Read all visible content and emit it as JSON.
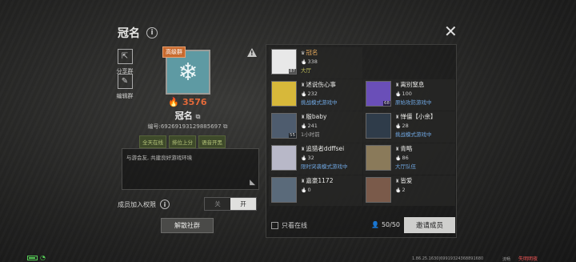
{
  "dialog": {
    "title": "冠名",
    "close_glyph": "✕"
  },
  "side_buttons": [
    {
      "label": "分享群",
      "icon": "share-icon"
    },
    {
      "label": "编辑群",
      "icon": "edit-icon"
    }
  ],
  "group": {
    "tier_label": "高级群",
    "heat": "3576",
    "name": "冠名",
    "id_text": "编号:69269193129885697",
    "tags": [
      "全天在线",
      "排位上分",
      "语音开黑"
    ],
    "description": "与游会友, 共建良好游戏环境",
    "permission_label": "成员加入权限",
    "toggle_off": "关",
    "toggle_on": "开",
    "toggle_state": "on",
    "disband_label": "解散社群"
  },
  "members": [
    {
      "name": "冠名",
      "score": "338",
      "status": "大厅",
      "status_type": "lobby",
      "owner": true,
      "level": "87",
      "avatar_color": "#e8e8e8"
    },
    {
      "name": "述说伤心事",
      "score": "232",
      "status": "挑战模式游戏中",
      "status_type": "playing",
      "owner": false,
      "level": "",
      "avatar_color": "#d7b83a"
    },
    {
      "name": "离别窒息",
      "score": "100",
      "status": "原始攻防游戏中",
      "status_type": "playing",
      "owner": false,
      "level": "68",
      "avatar_color": "#6a4fb8"
    },
    {
      "name": "殷baby",
      "score": "241",
      "status": "1小时前",
      "status_type": "idle",
      "owner": false,
      "level": "55",
      "avatar_color": "#4e5c6e"
    },
    {
      "name": "惮僵【小余】",
      "score": "28",
      "status": "挑战模式游戏中",
      "status_type": "playing",
      "owner": false,
      "level": "",
      "avatar_color": "#2f3c4a"
    },
    {
      "name": "追猎者ddffsei",
      "score": "32",
      "status": "限时突袭模式游戏中",
      "status_type": "playing",
      "owner": false,
      "level": "",
      "avatar_color": "#b8b8c8"
    },
    {
      "name": "青略",
      "score": "86",
      "status": "大厅队伍",
      "status_type": "playing",
      "owner": false,
      "level": "",
      "avatar_color": "#8a7a5a"
    },
    {
      "name": "嘉豪1172",
      "score": "0",
      "status": "",
      "status_type": "idle",
      "owner": false,
      "level": "",
      "avatar_color": "#5a6a7a"
    },
    {
      "name": "皆爱",
      "score": "2",
      "status": "",
      "status_type": "idle",
      "owner": false,
      "level": "",
      "avatar_color": "#7a5a4a"
    }
  ],
  "footer": {
    "online_only": "只看在线",
    "count": "50/50",
    "invite": "邀请成员"
  },
  "statusbar": {
    "version": "1.86.25.1630|69919324368891680",
    "network": "流畅",
    "logo_text": "失明明夜"
  },
  "colors": {
    "heat": "#e56a3a",
    "owner_name": "#e4a85c",
    "playing": "#6fa6e0"
  }
}
